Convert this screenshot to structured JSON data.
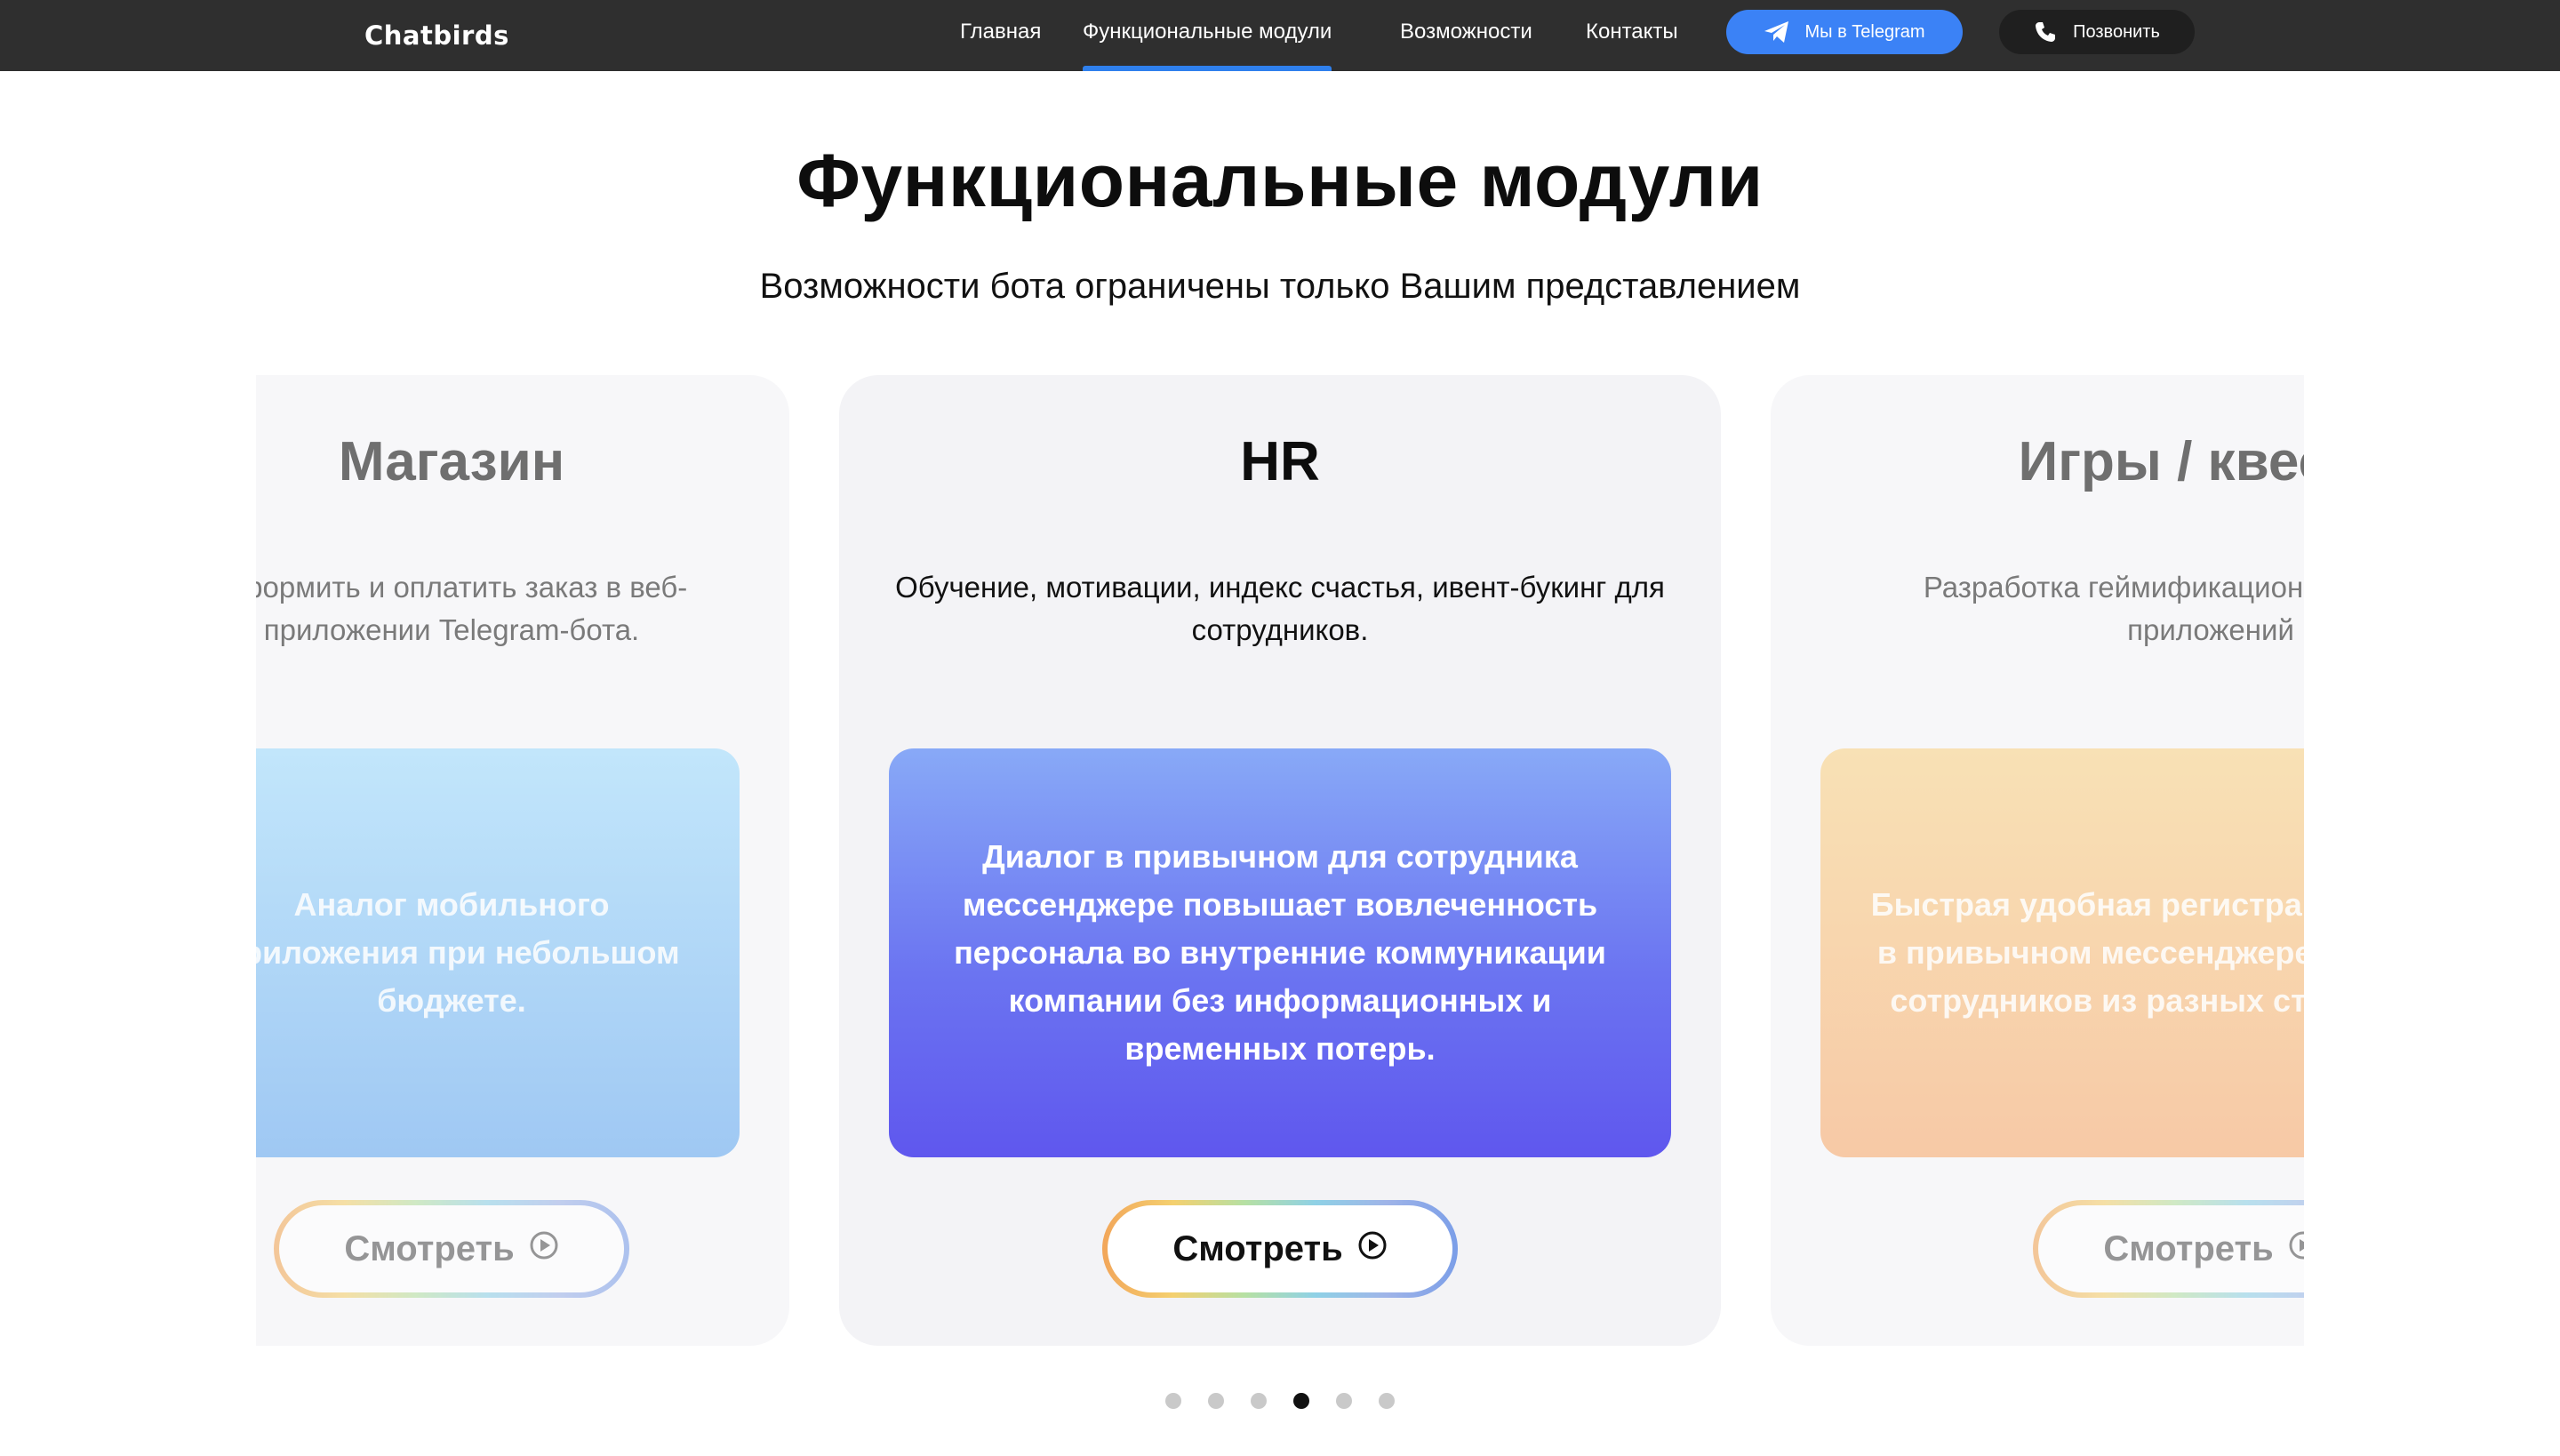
{
  "nav": {
    "logo": "Chatbirds",
    "links": [
      {
        "label": "Главная"
      },
      {
        "label": "Функциональные модули"
      },
      {
        "label": "Возможности"
      },
      {
        "label": "Контакты"
      }
    ],
    "active_index": 1,
    "telegram_button": {
      "label": "Мы в Telegram",
      "icon": "telegram-icon",
      "color": "#3b82f6"
    },
    "call_button": {
      "label": "Позвонить",
      "icon": "phone-icon"
    },
    "accent_color": "#2f80ed"
  },
  "page": {
    "title": "Функциональные модули",
    "subtitle": "Возможности бота ограничены только Вашим представлением"
  },
  "carousel": {
    "cards": [
      {
        "title": "Магазин",
        "visible_title": "Магазин",
        "description": "Оформить и оплатить заказ в веб-приложении Telegram-бота.",
        "panel_text": "Аналог мобильного приложения при небольшом бюджете.",
        "button": "Смотреть",
        "partial": "left"
      },
      {
        "title": "HR",
        "description": "Обучение, мотивации, индекс счастья, ивент-букинг для сотрудников.",
        "panel_text": "Диалог в привычном для сотрудника мессенджере повышает вовлеченность персонала во внутренние коммуникации компании без информационных и временных потерь.",
        "button": "Смотреть",
        "partial": "none"
      },
      {
        "title": "Игры / квесты",
        "description": "Разработка геймификационных диалога и приложений",
        "panel_text": "Быстрая удобная регистрация участников в привычном мессенджере, объединение сотрудников из разных стран и городов",
        "button": "Смотреть",
        "partial": "right"
      }
    ],
    "dots_count": 6,
    "active_dot": 3
  }
}
